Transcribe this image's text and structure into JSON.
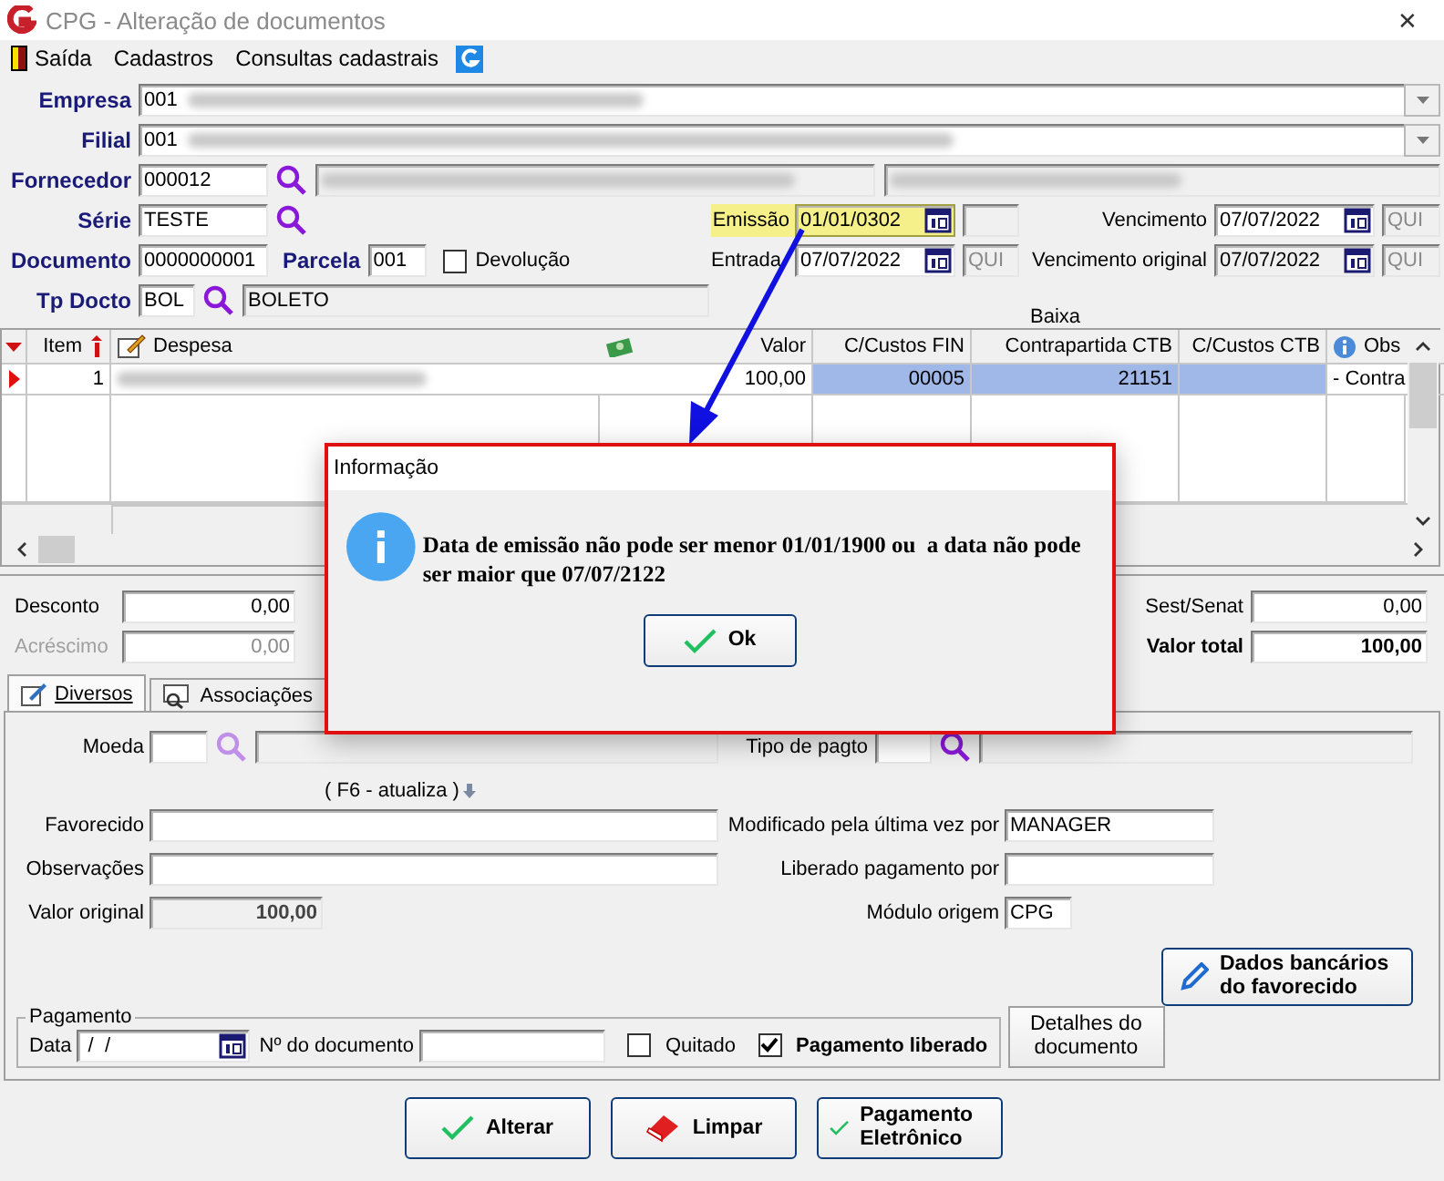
{
  "window": {
    "title": "CPG - Alteração de documentos",
    "close": "✕"
  },
  "menu": [
    {
      "label": "Saída",
      "kind": "exit"
    },
    {
      "label": "Cadastros",
      "kind": "text"
    },
    {
      "label": "Consultas cadastrais",
      "kind": "text"
    },
    {
      "kind": "logo"
    }
  ],
  "empresa": {
    "label": "Empresa",
    "code": "001"
  },
  "filial": {
    "label": "Filial",
    "code": "001"
  },
  "fornecedor": {
    "label": "Fornecedor",
    "code": "000012"
  },
  "serie": {
    "label": "Série",
    "value": "TESTE"
  },
  "emissao": {
    "label": "Emissão",
    "value": "01/01/0302",
    "highlighted": true
  },
  "vencimento": {
    "label": "Vencimento",
    "value": "07/07/2022",
    "weekday": "QUI",
    "disabled": false
  },
  "documento": {
    "label": "Documento",
    "value": "0000000001"
  },
  "parcela": {
    "label": "Parcela",
    "value": "001"
  },
  "devolucao": {
    "label": "Devolução",
    "checked": false
  },
  "entrada": {
    "label": "Entrada",
    "value": "07/07/2022",
    "weekday": "QUI"
  },
  "vencimento_original": {
    "label": "Vencimento original",
    "value": "07/07/2022",
    "weekday": "QUI",
    "disabled": true
  },
  "tp_docto": {
    "label": "Tp Docto",
    "code": "BOL",
    "description": "BOLETO"
  },
  "baixa": "Baixa",
  "table": {
    "columns": [
      "Item",
      "Despesa",
      "Valor",
      "C/Custos FIN",
      "Contrapartida CTB",
      "C/Custos CTB",
      "Obs"
    ],
    "rows": [
      {
        "item": "1",
        "valor": "100,00",
        "cc_fin": "00005",
        "contrapartida": "21151",
        "obs": "- Contra",
        "selected": true
      }
    ]
  },
  "totals": {
    "desconto": {
      "label": "Desconto",
      "value": "0,00",
      "disabled": false
    },
    "acrescimo": {
      "label": "Acréscimo",
      "value": "0,00",
      "disabled": true
    },
    "sest_senat": {
      "label": "Sest/Senat",
      "value": "0,00"
    },
    "valor_total": {
      "label": "Valor total",
      "value": "100,00"
    }
  },
  "tabs": [
    {
      "label": "Diversos",
      "selected": true
    },
    {
      "label": "Associações",
      "selected": false
    }
  ],
  "diversos": {
    "moeda": "Moeda",
    "tipo_pagto": "Tipo de pagto",
    "f6_hint": "( F6 - atualiza )",
    "favorecido": "Favorecido",
    "observacoes": "Observações",
    "valor_original": {
      "label": "Valor original",
      "value": "100,00"
    },
    "modificado": {
      "label": "Modificado pela última vez por",
      "value": "MANAGER"
    },
    "liberado": {
      "label": "Liberado pagamento por"
    },
    "modulo": {
      "label": "Módulo origem",
      "value": "CPG"
    },
    "dados_bancarios": "Dados bancários do favorecido",
    "pagamento": {
      "title": "Pagamento",
      "data_label": "Data",
      "data_value": " /  /",
      "num_doc_label": "Nº do documento",
      "quitado": {
        "label": "Quitado",
        "checked": false
      },
      "liberado": {
        "label": "Pagamento liberado",
        "checked": true
      }
    },
    "detalhes": "Detalhes do documento"
  },
  "buttons": [
    {
      "label": "Alterar",
      "kind": "check"
    },
    {
      "label": "Limpar",
      "kind": "eraser"
    },
    {
      "label": "Pagamento Eletrônico",
      "kind": "check"
    }
  ],
  "dialog": {
    "title": "Informação",
    "message": "Data de emissão não pode ser menor 01/01/1900 ou  a data não pode ser maior que 07/07/2122",
    "button": "Ok"
  }
}
